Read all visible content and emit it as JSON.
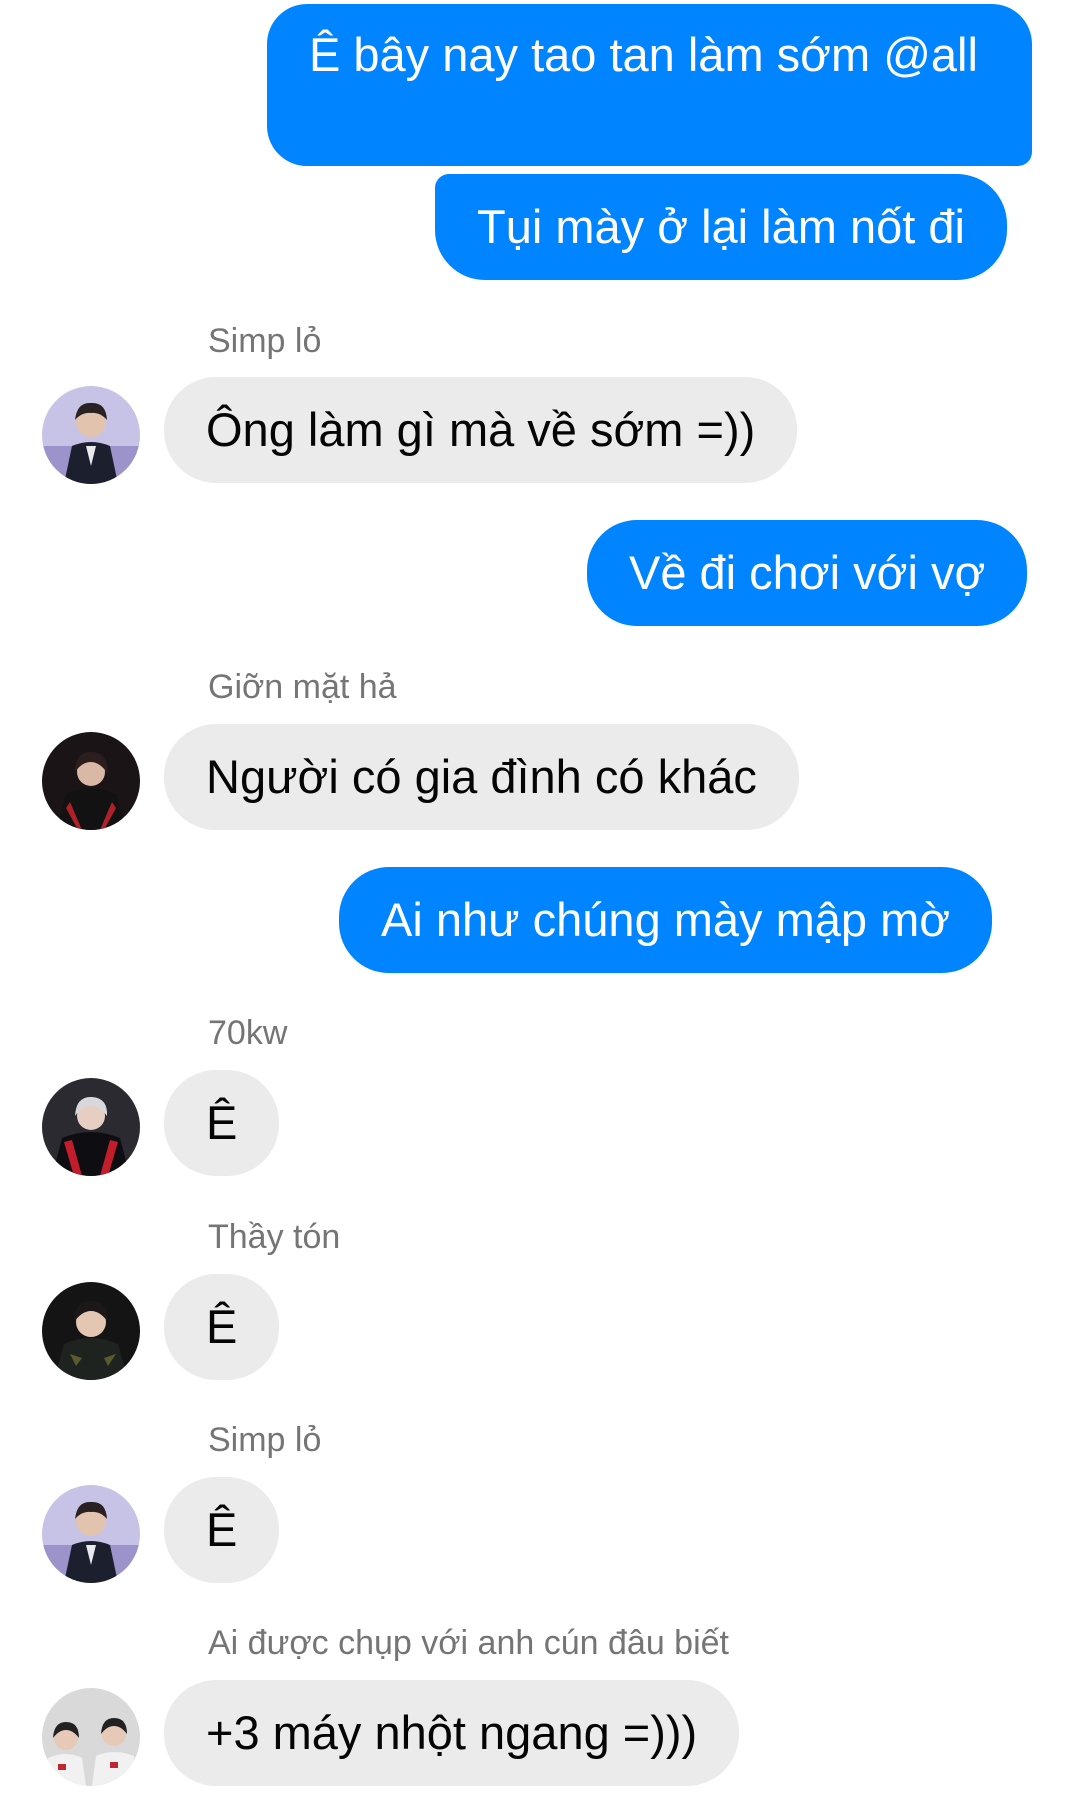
{
  "messages": [
    {
      "type": "outgoing",
      "text": "Ê bây nay tao tan làm sớm @all"
    },
    {
      "type": "outgoing",
      "text": "Tụi mày ở lại làm nốt đi"
    },
    {
      "type": "incoming",
      "sender": "Simp lỏ",
      "avatar": "avatar-man-suit",
      "text": "Ông làm gì mà về sớm =))"
    },
    {
      "type": "outgoing",
      "text": "Về đi chơi với vợ"
    },
    {
      "type": "incoming",
      "sender": "Giỡn mặt hả",
      "avatar": "avatar-red-jacket",
      "text": "Người có gia đình có khác"
    },
    {
      "type": "outgoing",
      "text": "Ai như chúng mày mập mờ"
    },
    {
      "type": "incoming",
      "sender": "70kw",
      "avatar": "avatar-team-jersey",
      "text": "Ê"
    },
    {
      "type": "incoming",
      "sender": "Thầy tón",
      "avatar": "avatar-dark-portrait",
      "text": "Ê"
    },
    {
      "type": "incoming",
      "sender": "Simp lỏ",
      "avatar": "avatar-man-suit",
      "text": "Ê"
    },
    {
      "type": "incoming",
      "sender": "Ai được chụp với anh cún đâu biết",
      "avatar": "avatar-group-photo",
      "text": "+3 máy nhột ngang =)))"
    }
  ],
  "colors": {
    "outgoing_bubble": "#0084ff",
    "incoming_bubble": "#ebebeb",
    "sender_text": "#757575"
  }
}
